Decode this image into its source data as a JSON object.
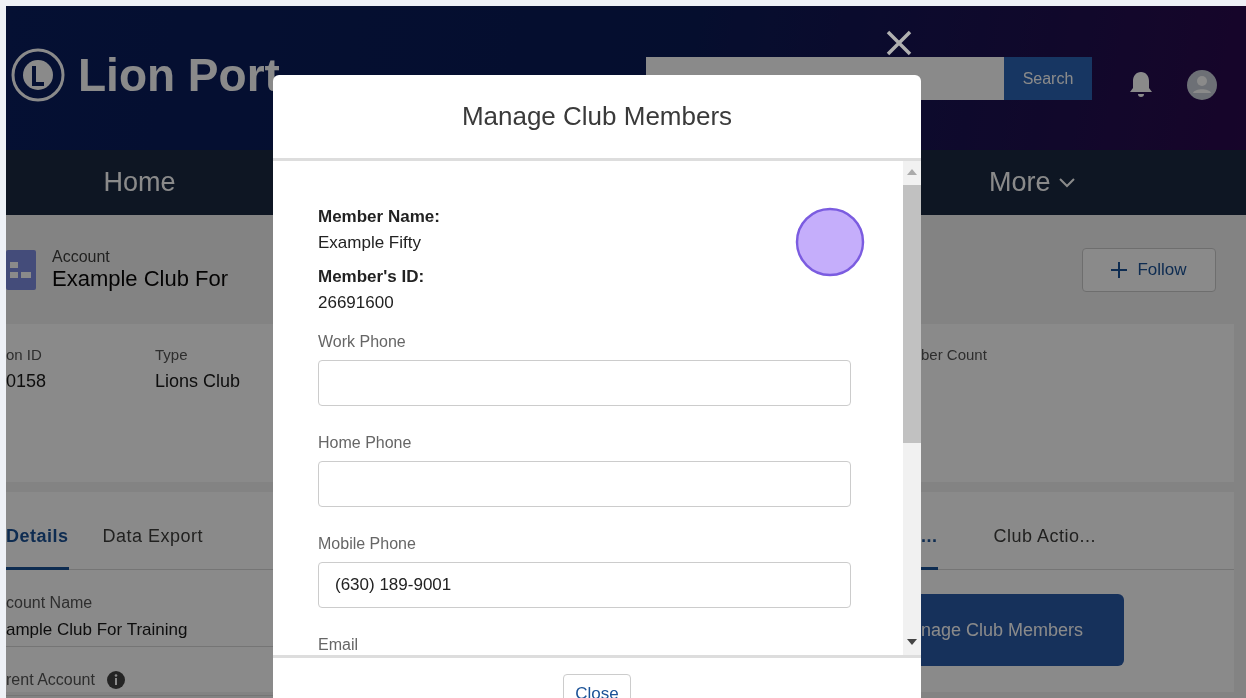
{
  "header": {
    "logo_text": "Lion Port",
    "search": {
      "button": "Search"
    }
  },
  "nav": [
    {
      "label": "Home",
      "dropdown": false
    },
    {
      "label": "More",
      "dropdown": true
    }
  ],
  "record": {
    "object_type": "Account",
    "name": "Example Club For",
    "follow_button": "Follow"
  },
  "highlights": [
    {
      "label": "on ID",
      "value": "0158"
    },
    {
      "label": "Type",
      "value": "Lions Club"
    },
    {
      "label": "ber Count"
    }
  ],
  "tabs_left": [
    {
      "label": "Details",
      "selected": true
    },
    {
      "label": "Data Export",
      "selected": false
    }
  ],
  "detail_fields": [
    {
      "label": "count Name",
      "value": "ample Club For Training",
      "info": false
    },
    {
      "label": "rent Account",
      "info": true
    }
  ],
  "tabs_right": [
    {
      "label": "...",
      "selected": true
    },
    {
      "label": "Club Actio...",
      "selected": false
    }
  ],
  "action_button": "nage Club Members",
  "modal": {
    "title": "Manage Club Members",
    "member_name_label": "Member Name:",
    "member_name": "Example Fifty",
    "member_id_label": "Member's ID:",
    "member_id": "26691600",
    "fields": [
      {
        "label": "Work Phone"
      },
      {
        "label": "Home Phone"
      },
      {
        "label": "Mobile Phone",
        "value": "(630) 189-9001"
      },
      {
        "label": "Email"
      }
    ],
    "footer_button": "Close"
  }
}
